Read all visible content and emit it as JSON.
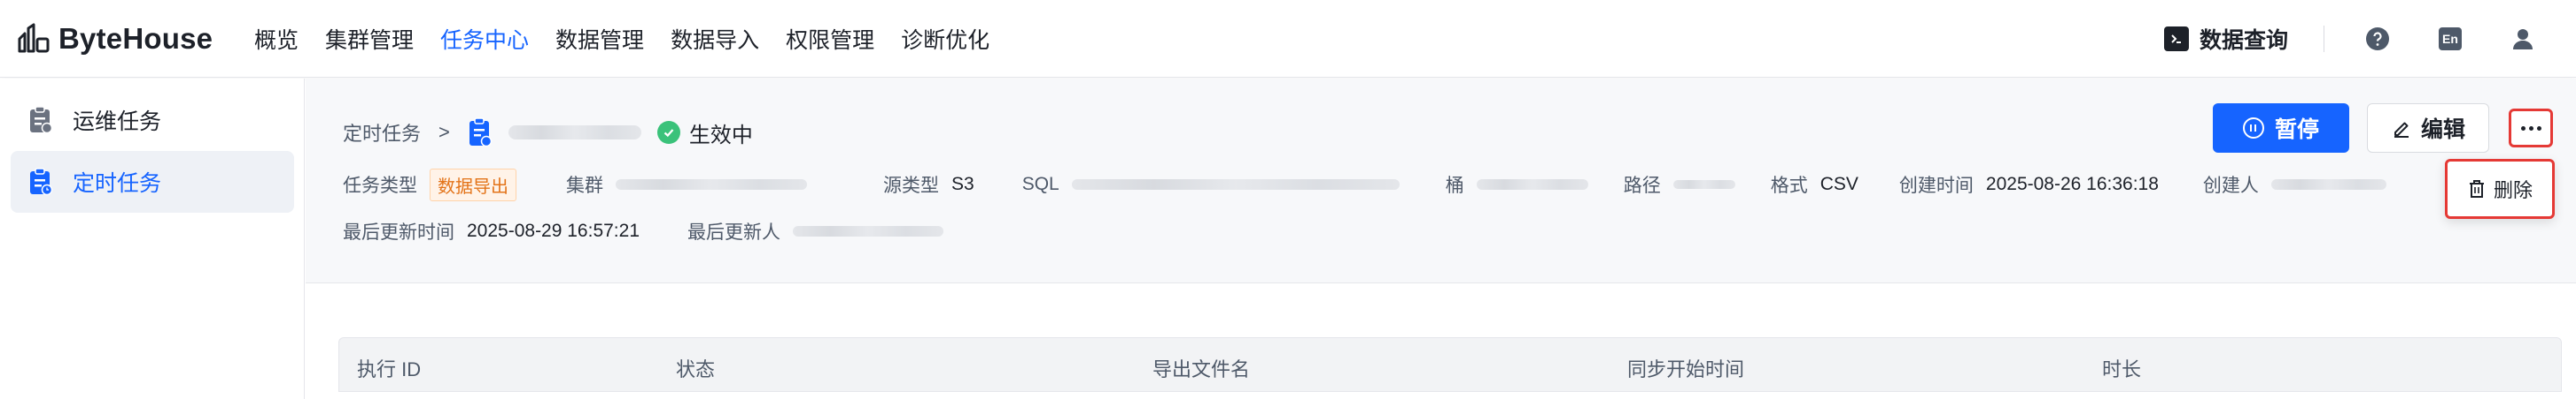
{
  "brand": {
    "name": "ByteHouse"
  },
  "nav": {
    "items": [
      {
        "label": "概览"
      },
      {
        "label": "集群管理"
      },
      {
        "label": "任务中心",
        "active": true
      },
      {
        "label": "数据管理"
      },
      {
        "label": "数据导入"
      },
      {
        "label": "权限管理"
      },
      {
        "label": "诊断优化"
      }
    ]
  },
  "topright": {
    "query_label": "数据查询",
    "help_icon": "help-icon",
    "lang_label": "En",
    "user_icon": "user-icon"
  },
  "sidebar": {
    "items": [
      {
        "label": "运维任务",
        "icon": "ops-task-icon"
      },
      {
        "label": "定时任务",
        "icon": "scheduled-task-icon",
        "active": true
      }
    ]
  },
  "breadcrumb": {
    "parent": "定时任务",
    "separator": ">",
    "status": "生效中",
    "status_color": "#3ac27a"
  },
  "actions": {
    "pause_label": "暂停",
    "edit_label": "编辑",
    "more_icon": "more-icon"
  },
  "dropdown": {
    "delete_label": "删除"
  },
  "meta": {
    "task_type_key": "任务类型",
    "task_type_value": "数据导出",
    "cluster_key": "集群",
    "source_type_key": "源类型",
    "source_type_value": "S3",
    "sql_key": "SQL",
    "bucket_key": "桶",
    "path_key": "路径",
    "format_key": "格式",
    "format_value": "CSV",
    "created_time_key": "创建时间",
    "created_time_value": "2025-08-26 16:36:18",
    "creator_key": "创建人",
    "updated_time_key": "最后更新时间",
    "updated_time_value": "2025-08-29 16:57:21",
    "updater_key": "最后更新人"
  },
  "table": {
    "columns": [
      "执行 ID",
      "状态",
      "导出文件名",
      "同步开始时间",
      "时长"
    ]
  },
  "colors": {
    "accent": "#1664ff",
    "highlight": "#e53935",
    "tag": "#e37318"
  }
}
